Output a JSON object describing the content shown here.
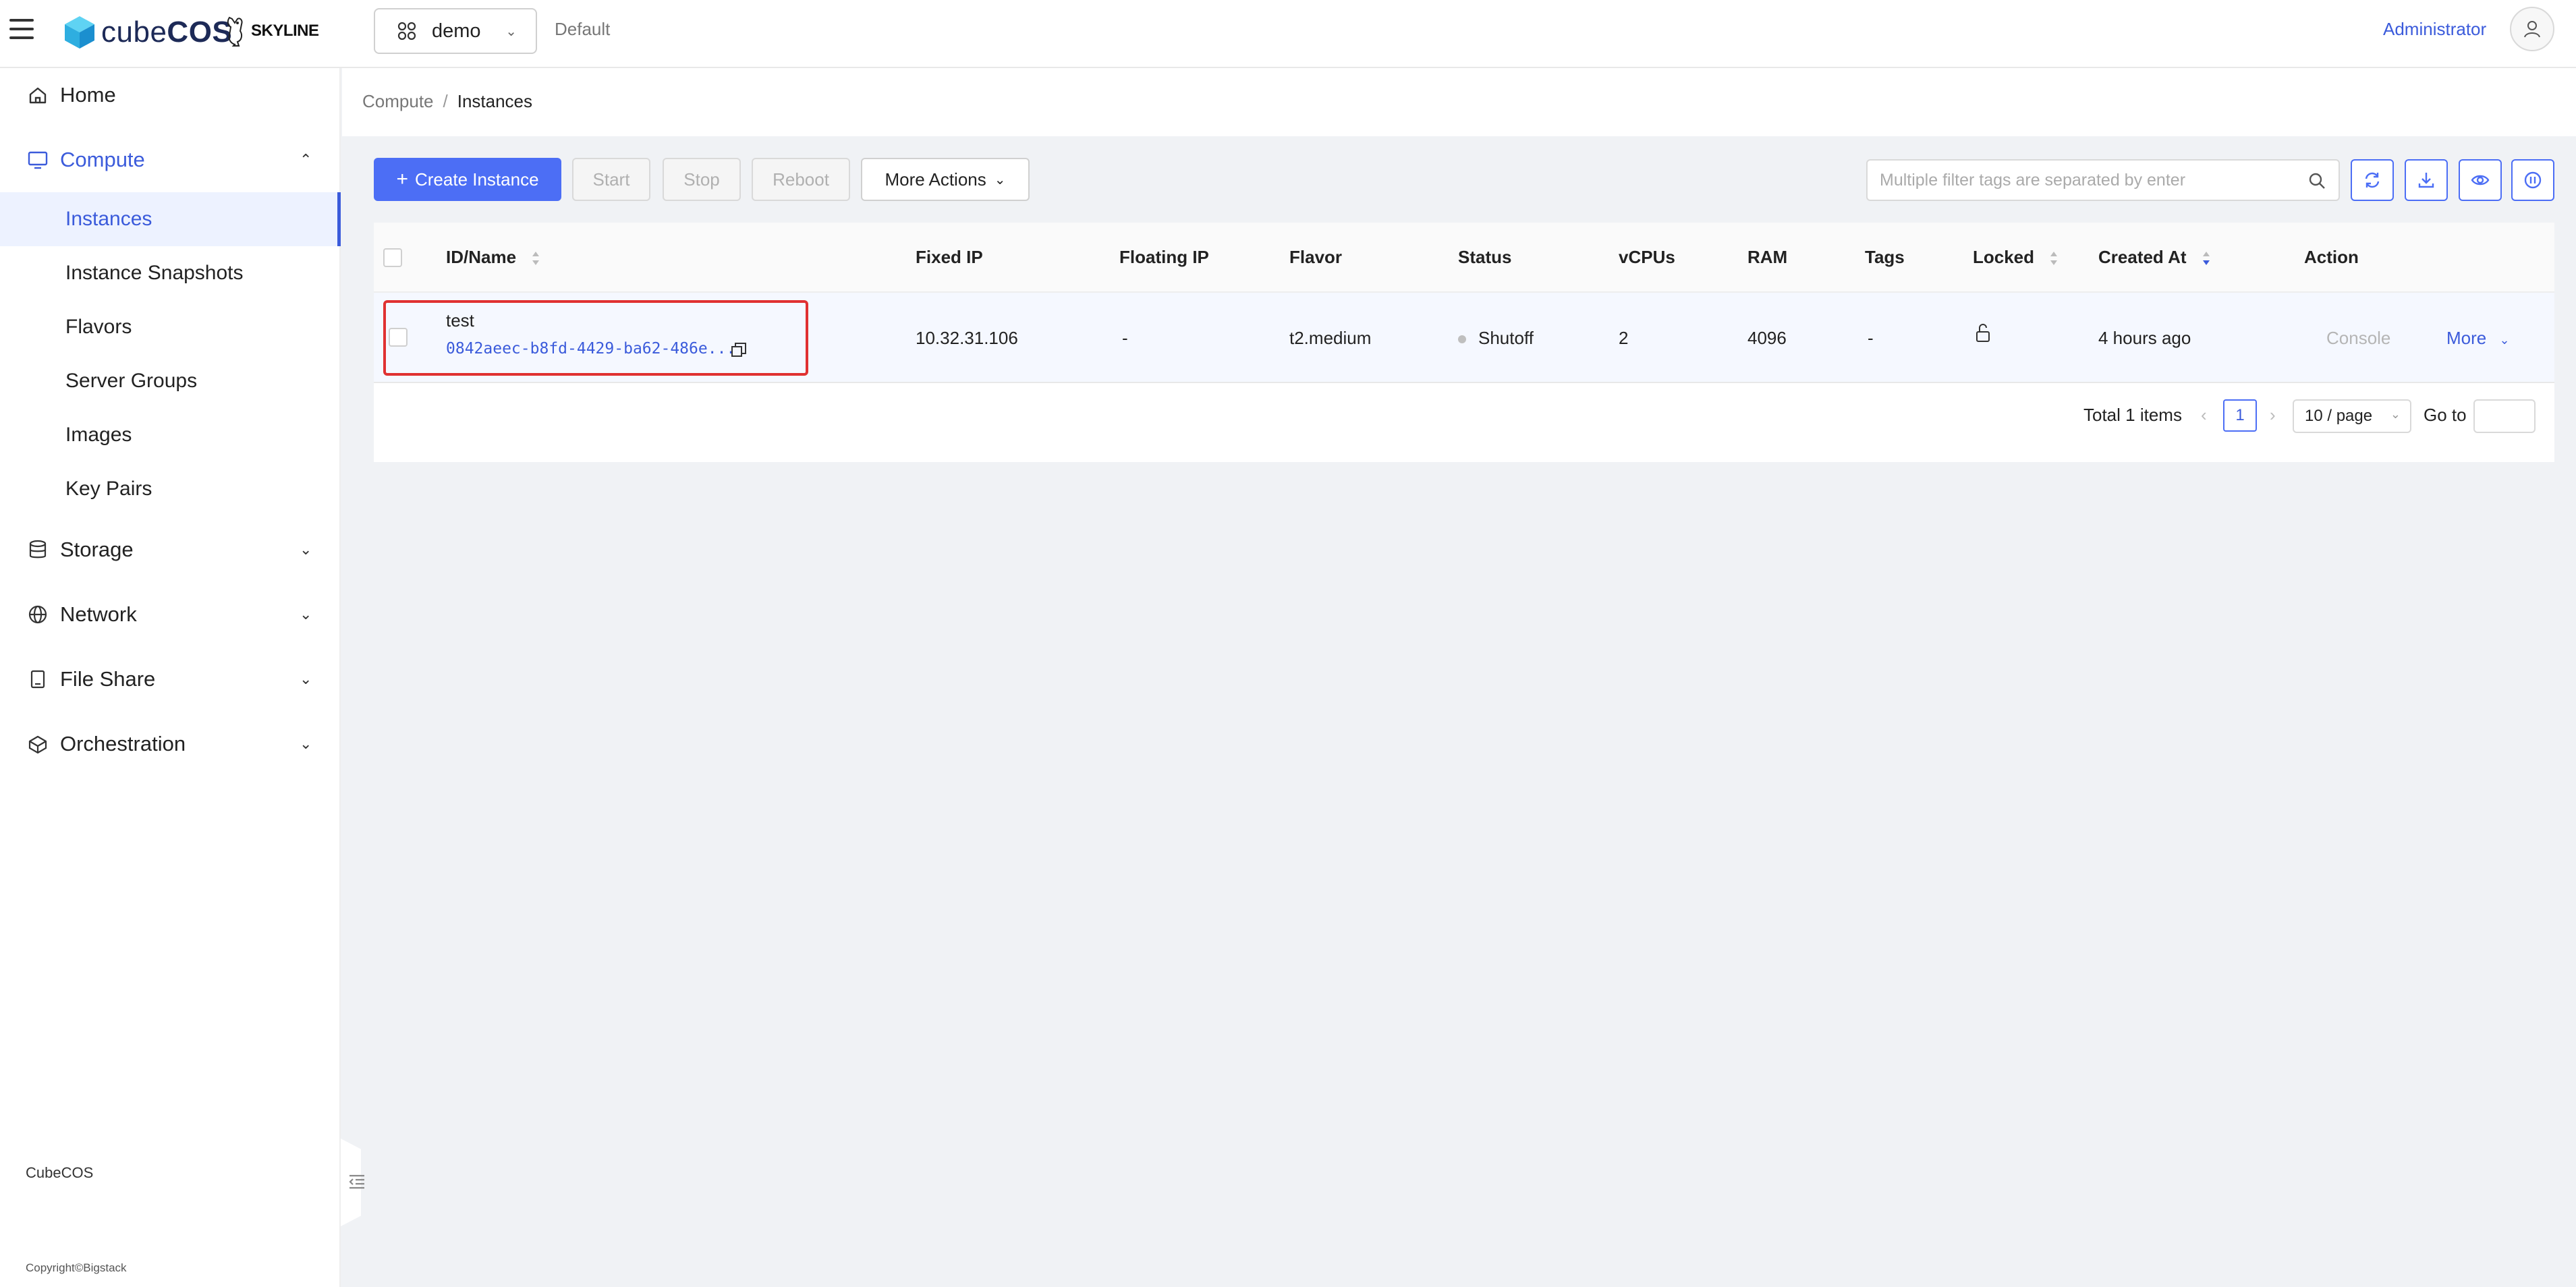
{
  "header": {
    "brand": "cubeCOS",
    "brand_light": "cube",
    "brand_bold": "COS",
    "skyline": "SKYLINE",
    "project": "demo",
    "domain": "Default",
    "user": "Administrator"
  },
  "sidebar": {
    "items": [
      {
        "label": "Home",
        "icon": "home-icon"
      },
      {
        "label": "Compute",
        "icon": "monitor-icon",
        "expanded": true
      },
      {
        "label": "Storage",
        "icon": "database-icon"
      },
      {
        "label": "Network",
        "icon": "globe-icon"
      },
      {
        "label": "File Share",
        "icon": "file-share-icon"
      },
      {
        "label": "Orchestration",
        "icon": "orchestration-icon"
      }
    ],
    "compute_children": [
      "Instances",
      "Instance Snapshots",
      "Flavors",
      "Server Groups",
      "Images",
      "Key Pairs"
    ],
    "footer_title": "CubeCOS",
    "footer_copyright": "Copyright©Bigstack"
  },
  "breadcrumb": {
    "parent": "Compute",
    "separator": "/",
    "current": "Instances"
  },
  "toolbar": {
    "create": "Create Instance",
    "start": "Start",
    "stop": "Stop",
    "reboot": "Reboot",
    "more_actions": "More Actions",
    "search_placeholder": "Multiple filter tags are separated by enter"
  },
  "table": {
    "columns": [
      "ID/Name",
      "Fixed IP",
      "Floating IP",
      "Flavor",
      "Status",
      "vCPUs",
      "RAM",
      "Tags",
      "Locked",
      "Created At",
      "Action"
    ],
    "rows": [
      {
        "name": "test",
        "id": "0842aeec-b8fd-4429-ba62-486e...",
        "fixed_ip": "10.32.31.106",
        "floating_ip": "-",
        "flavor": "t2.medium",
        "status": "Shutoff",
        "vcpus": "2",
        "ram": "4096",
        "tags": "-",
        "created_at": "4 hours ago",
        "action_console": "Console",
        "action_more": "More"
      }
    ]
  },
  "pagination": {
    "total": "Total 1 items",
    "current_page": "1",
    "page_size": "10 / page",
    "goto_label": "Go to"
  },
  "colors": {
    "accent": "#4c6ef5",
    "link": "#3b5bdb",
    "highlight": "#e03131"
  }
}
